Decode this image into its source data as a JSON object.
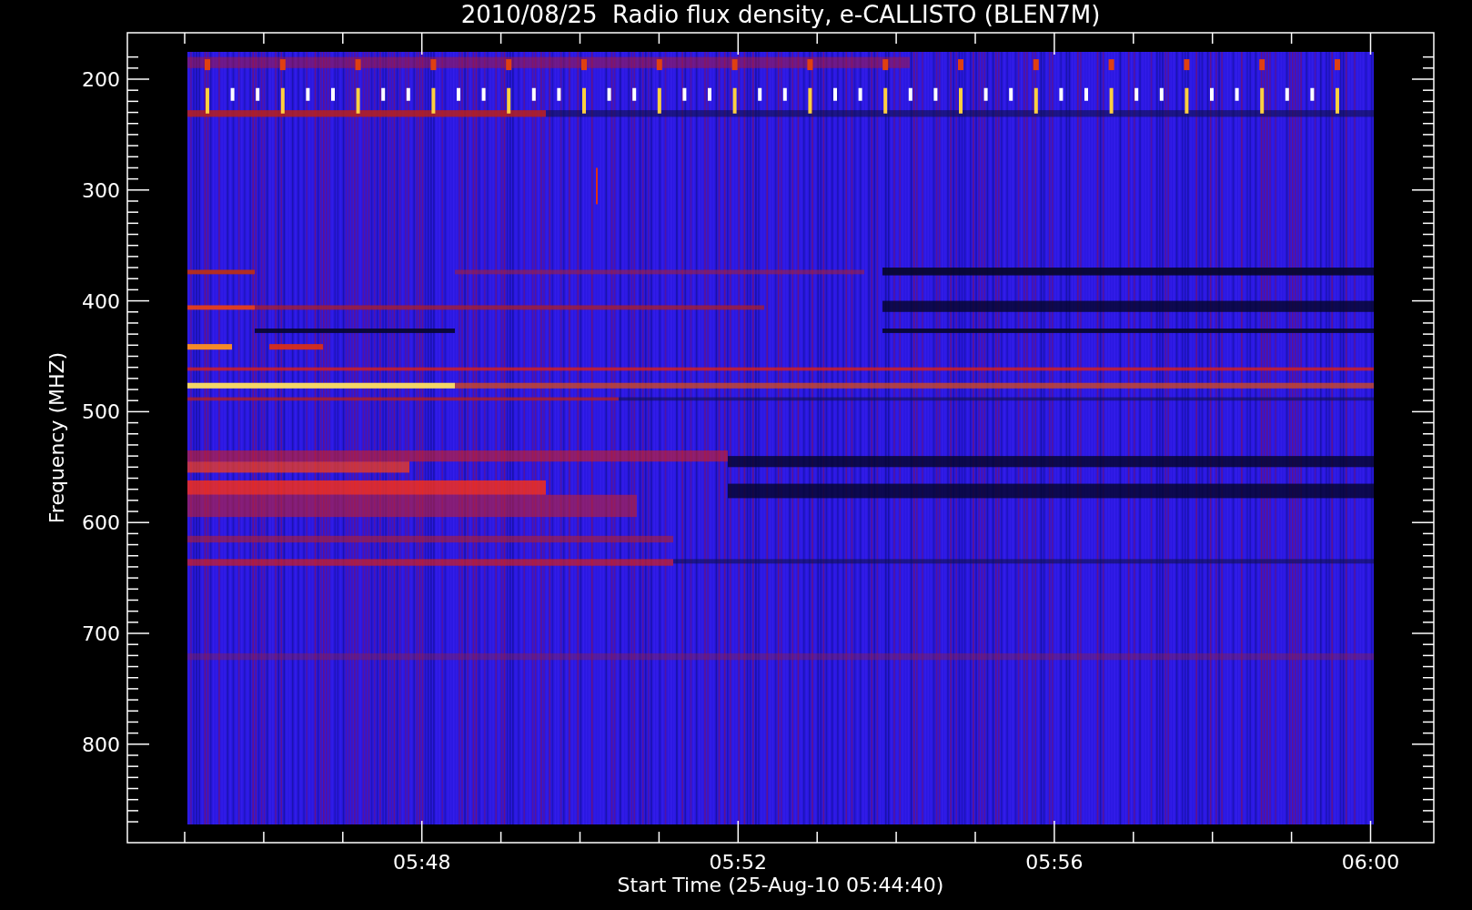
{
  "title": "2010/08/25  Radio flux density, e-CALLISTO (BLEN7M)",
  "y_axis": {
    "label": "Frequency (MHZ)",
    "ticks": [
      "200",
      "300",
      "400",
      "500",
      "600",
      "700",
      "800"
    ]
  },
  "x_axis": {
    "label": "Start Time (25-Aug-10 05:44:40)",
    "ticks": [
      "05:48",
      "05:52",
      "05:56",
      "06:00"
    ]
  }
}
